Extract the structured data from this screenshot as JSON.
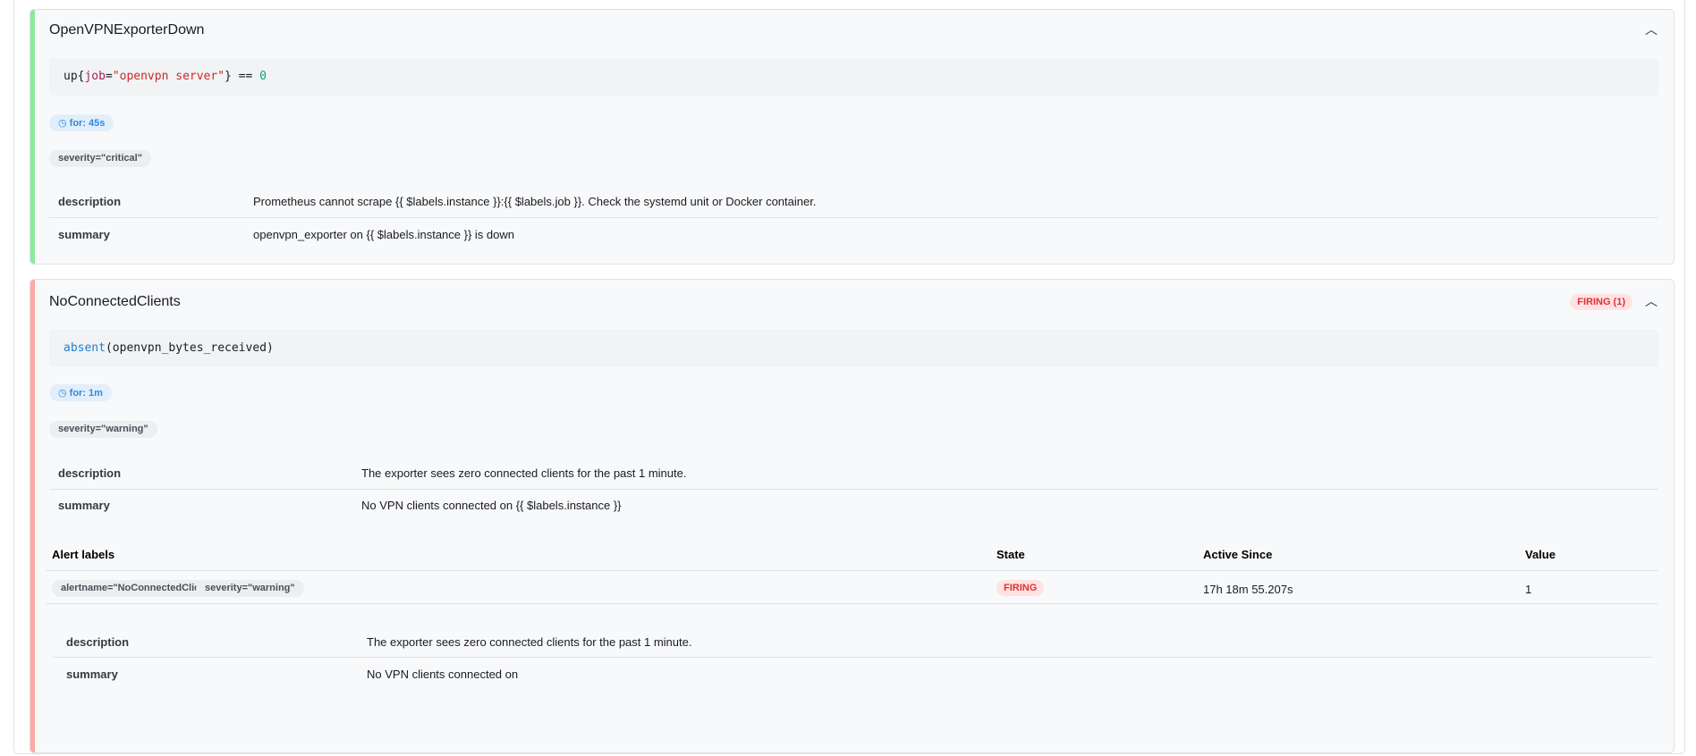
{
  "rules": [
    {
      "name": "OpenVPNExporterDown",
      "expr": {
        "fn": "up",
        "label_key": "job",
        "label_val": "\"openvpn server\"",
        "rest": "} == ",
        "num": "0"
      },
      "for": "for: 45s",
      "labels": [
        "severity=\"critical\""
      ],
      "annotations": [
        {
          "key": "description",
          "value": "Prometheus cannot scrape {{ $labels.instance }}:{{ $labels.job }}. Check the systemd unit or Docker container."
        },
        {
          "key": "summary",
          "value": "openvpn_exporter on {{ $labels.instance }} is down"
        }
      ],
      "status_color": "#8ce99a"
    },
    {
      "name": "NoConnectedClients",
      "badge": "FIRING (1)",
      "expr": {
        "fn": "absent",
        "arg": "(openvpn_bytes_received)"
      },
      "for": "for: 1m",
      "labels": [
        "severity=\"warning\""
      ],
      "annotations": [
        {
          "key": "description",
          "value": "The exporter sees zero connected clients for the past 1 minute."
        },
        {
          "key": "summary",
          "value": "No VPN clients connected on {{ $labels.instance }}"
        }
      ],
      "status_color": "#ffa8a8",
      "alerts_table": {
        "headers": [
          "Alert labels",
          "State",
          "Active Since",
          "Value"
        ],
        "rows": [
          {
            "labels": [
              "alertname=\"NoConnectedClients\"",
              "severity=\"warning\""
            ],
            "state": "FIRING",
            "active_since": "17h 18m 55.207s",
            "value": "1",
            "annotations": [
              {
                "key": "description",
                "value": "The exporter sees zero connected clients for the past 1 minute."
              },
              {
                "key": "summary",
                "value": "No VPN clients connected on"
              }
            ]
          }
        ]
      }
    }
  ]
}
